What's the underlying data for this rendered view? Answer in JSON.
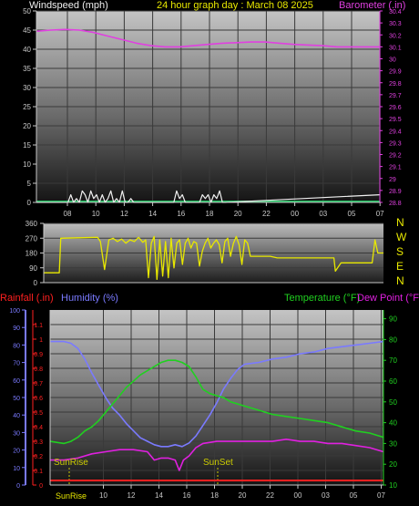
{
  "colors": {
    "background": "#000000",
    "grid": "#3a3a3a",
    "axis": "#c8c8c8",
    "wind_label": "#f0f0f0",
    "title": "#e8e800",
    "barometer": "#e040e0",
    "wind_dir": "#e8e800",
    "rainfall": "#ff2020",
    "humidity": "#7a7aff",
    "temperature": "#20d020",
    "dewpoint": "#e020e0",
    "sunrise": "#cccc00",
    "compass": "#e8e800"
  },
  "labels": {
    "windspeed": "Windspeed (mph)",
    "title": "24 hour graph day : March 08 2025",
    "barometer": "Barometer (.in)",
    "rainfall": "Rainfall (.in)",
    "humidity": "Humidity (%)",
    "temperature": "Temperature (°F)",
    "dewpoint": "Dew Point (°F)",
    "sunrise": "SunRise",
    "sunset": "SunSet",
    "bottom_sun": "SunRise"
  },
  "compass": [
    "N",
    "W",
    "S",
    "E",
    "N"
  ],
  "chart_data": [
    {
      "type": "line",
      "name": "wind-baro",
      "x_ticks": [
        "08",
        "10",
        "12",
        "14",
        "16",
        "18",
        "20",
        "22",
        "00",
        "03",
        "05",
        "07"
      ],
      "left_axis": {
        "label": "Windspeed (mph)",
        "ylim": [
          0,
          50
        ],
        "ticks": [
          0,
          5,
          10,
          15,
          20,
          25,
          30,
          35,
          40,
          45,
          50
        ]
      },
      "right_axis": {
        "label": "Barometer (.in)",
        "ylim": [
          28.8,
          30.4
        ],
        "ticks": [
          "28.8",
          "28.9",
          "29",
          "29.1",
          "29.2",
          "29.3",
          "29.4",
          "29.5",
          "29.6",
          "29.7",
          "29.8",
          "29.9",
          "30",
          "30.1",
          "30.2",
          "30.3",
          "30.4"
        ]
      },
      "series": [
        {
          "name": "Barometer (.in)",
          "axis": "right",
          "x": [
            0,
            1,
            2,
            3,
            4,
            5,
            6,
            7,
            8,
            9,
            10,
            11,
            12,
            13,
            14,
            15,
            16,
            17,
            18,
            19,
            20,
            21,
            22,
            23,
            24
          ],
          "values": [
            30.23,
            30.24,
            30.245,
            30.24,
            30.22,
            30.19,
            30.16,
            30.13,
            30.11,
            30.1,
            30.1,
            30.11,
            30.12,
            30.13,
            30.135,
            30.14,
            30.14,
            30.13,
            30.12,
            30.115,
            30.11,
            30.1,
            30.1,
            30.1,
            30.1
          ]
        },
        {
          "name": "Windspeed (mph)",
          "axis": "left",
          "x": [
            0,
            2.2,
            2.4,
            2.6,
            2.8,
            3.0,
            3.2,
            3.4,
            3.6,
            3.8,
            4.0,
            4.2,
            4.4,
            4.6,
            4.8,
            5.0,
            5.2,
            5.4,
            5.6,
            5.8,
            6.0,
            6.2,
            6.4,
            6.6,
            6.8,
            7.0,
            7.2,
            9.6,
            9.8,
            10.0,
            10.2,
            10.4,
            10.6,
            11.4,
            11.6,
            11.8,
            12.0,
            12.2,
            12.4,
            12.6,
            12.8,
            13.0,
            13.2,
            24
          ],
          "values": [
            0,
            0,
            2,
            0,
            1,
            0,
            3,
            2,
            0,
            3,
            1,
            2,
            0,
            2,
            0,
            1,
            3,
            0,
            1,
            0,
            3,
            0,
            0,
            1,
            0,
            0,
            0,
            0,
            3,
            1,
            2,
            0,
            0,
            0,
            2,
            1,
            2,
            0,
            2,
            1,
            3,
            0,
            0,
            2
          ]
        }
      ]
    },
    {
      "type": "line",
      "name": "wind-direction",
      "ylim": [
        0,
        360
      ],
      "ticks": [
        0,
        90,
        180,
        270,
        360
      ],
      "series": [
        {
          "name": "Wind direction",
          "x": [
            0,
            1.1,
            1.2,
            3.8,
            4.0,
            4.3,
            4.6,
            4.9,
            5.2,
            5.5,
            5.8,
            6.1,
            6.4,
            6.7,
            7.0,
            7.2,
            7.4,
            7.6,
            7.8,
            8.0,
            8.2,
            8.4,
            8.6,
            8.8,
            9.0,
            9.2,
            9.4,
            9.6,
            9.8,
            10.0,
            10.2,
            10.4,
            10.6,
            10.8,
            11.0,
            11.2,
            11.4,
            11.6,
            11.8,
            12.0,
            12.2,
            12.4,
            12.6,
            12.8,
            13.0,
            13.2,
            13.4,
            13.6,
            13.8,
            14.0,
            14.2,
            14.4,
            14.6,
            15.0,
            15.5,
            16.0,
            16.5,
            17.0,
            17.5,
            18.0,
            18.5,
            19.0,
            19.5,
            20.0,
            20.5,
            20.6,
            21.0,
            21.5,
            22.0,
            22.5,
            23.0,
            23.2,
            23.4,
            23.6,
            24
          ],
          "values": [
            60,
            60,
            270,
            275,
            250,
            80,
            260,
            270,
            250,
            265,
            240,
            260,
            250,
            275,
            245,
            260,
            30,
            240,
            280,
            20,
            260,
            40,
            250,
            30,
            270,
            90,
            240,
            260,
            110,
            240,
            270,
            210,
            250,
            240,
            100,
            190,
            240,
            270,
            210,
            240,
            260,
            230,
            120,
            250,
            270,
            160,
            240,
            280,
            230,
            110,
            260,
            240,
            160,
            160,
            160,
            160,
            150,
            150,
            150,
            150,
            150,
            150,
            150,
            150,
            150,
            70,
            120,
            120,
            120,
            120,
            120,
            120,
            260,
            180,
            180
          ]
        }
      ]
    },
    {
      "type": "line",
      "name": "rain-humidity-temp",
      "x_ticks": [
        "Sunrise",
        "10",
        "12",
        "14",
        "16",
        "18",
        "20",
        "22",
        "00",
        "03",
        "05",
        "07"
      ],
      "left_axes": [
        {
          "label": "Rainfall (.in)",
          "ylim": [
            0,
            1.2
          ],
          "ticks": [
            "0",
            "0.1",
            "0.2",
            "0.3",
            "0.4",
            "0.5",
            "0.6",
            "0.7",
            "0.8",
            "0.9",
            "1",
            "1.1"
          ]
        },
        {
          "label": "Humidity (%)",
          "ylim": [
            0,
            100
          ],
          "ticks": [
            0,
            10,
            20,
            30,
            40,
            50,
            60,
            70,
            80,
            90,
            100
          ]
        }
      ],
      "right_axis": {
        "label": "Temperature (°F)",
        "ylim": [
          10,
          90
        ],
        "ticks": [
          10,
          20,
          30,
          40,
          50,
          60,
          70,
          80,
          90
        ]
      },
      "series": [
        {
          "name": "Humidity (%)",
          "axis": "humidity",
          "x": [
            0,
            1,
            1.5,
            2,
            2.5,
            3,
            3.5,
            4,
            4.5,
            5,
            5.5,
            6,
            6.5,
            7,
            7.5,
            8,
            8.5,
            9,
            9.5,
            10,
            10.5,
            11,
            11.5,
            12,
            12.5,
            13,
            13.5,
            14,
            15,
            16,
            17,
            18,
            19,
            20,
            21,
            22,
            23,
            24
          ],
          "values": [
            82,
            82,
            81,
            78,
            72,
            64,
            57,
            50,
            44,
            40,
            35,
            31,
            27,
            25,
            23,
            22,
            22,
            23,
            22,
            24,
            28,
            34,
            40,
            47,
            55,
            61,
            66,
            69,
            70,
            72,
            73,
            75,
            76,
            78,
            79,
            80,
            81,
            82
          ]
        },
        {
          "name": "Temperature (°F)",
          "axis": "right",
          "x": [
            0,
            1,
            1.5,
            2,
            2.5,
            3,
            3.5,
            4,
            4.5,
            5,
            5.5,
            6,
            6.5,
            7,
            7.5,
            8,
            8.5,
            9,
            9.5,
            10,
            10.5,
            11,
            11.5,
            12,
            12.5,
            13,
            14,
            15,
            16,
            17,
            18,
            19,
            20,
            21,
            22,
            23,
            24
          ],
          "values": [
            31,
            30,
            31,
            33,
            36,
            38,
            41,
            45,
            49,
            53,
            57,
            60,
            63,
            65,
            67,
            69,
            70,
            70,
            69,
            67,
            62,
            56,
            54,
            53,
            52,
            50,
            48,
            46,
            44,
            43,
            42,
            41,
            40,
            38,
            36,
            35,
            33
          ]
        },
        {
          "name": "Dew Point (°F)",
          "axis": "right",
          "x": [
            0,
            1,
            2,
            3,
            4,
            5,
            6,
            7,
            7.5,
            8,
            8.5,
            9,
            9.3,
            9.6,
            10,
            10.5,
            11,
            12,
            13,
            14,
            15,
            16,
            17,
            18,
            19,
            20,
            21,
            22,
            23,
            24
          ],
          "values": [
            22,
            22,
            23,
            25,
            26,
            27,
            27,
            26,
            22,
            23,
            23,
            22,
            17,
            22,
            24,
            28,
            30,
            31,
            31,
            31,
            31,
            31,
            32,
            31,
            31,
            30,
            30,
            29,
            28,
            26
          ]
        },
        {
          "name": "Rainfall (.in)",
          "axis": "rain",
          "x": [
            0,
            24
          ],
          "values": [
            0,
            0
          ]
        }
      ]
    }
  ]
}
